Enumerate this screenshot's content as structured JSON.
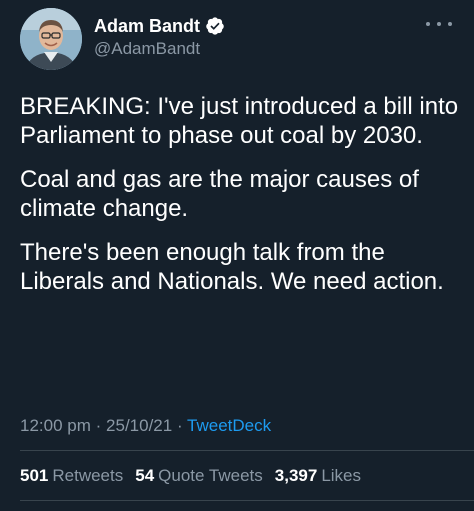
{
  "author": {
    "display_name": "Adam Bandt",
    "handle": "@AdamBandt",
    "verified": true
  },
  "tweet": {
    "paragraphs": [
      "BREAKING: I've just introduced a bill into Parliament to phase out coal by 2030.",
      "Coal and gas are the major causes of climate change.",
      "There's been enough talk from the Liberals and Nationals. We need action."
    ],
    "time": "12:00 pm",
    "date": "25/10/21",
    "separator": "·",
    "source": "TweetDeck"
  },
  "stats": {
    "retweets_count": "501",
    "retweets_label": "Retweets",
    "quote_count": "54",
    "quote_label": "Quote Tweets",
    "likes_count": "3,397",
    "likes_label": "Likes"
  },
  "icons": {
    "verified": "verified-badge-icon",
    "more": "more-options-icon"
  },
  "colors": {
    "background": "#15202b",
    "text": "#ffffff",
    "secondary": "#8b98a5",
    "accent": "#1d9bf0",
    "divider": "#38444d"
  }
}
